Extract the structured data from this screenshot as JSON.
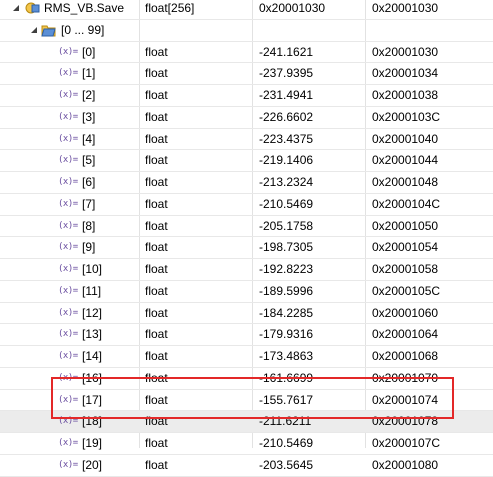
{
  "rows": [
    {
      "name": "RMS_VB.Save",
      "type": "float[256]",
      "value": "0x20001030",
      "location": "0x20001030"
    },
    {
      "name": "[0 ... 99]",
      "type": "",
      "value": "",
      "location": ""
    },
    {
      "name": "[0]",
      "type": "float",
      "value": "-241.1621",
      "location": "0x20001030"
    },
    {
      "name": "[1]",
      "type": "float",
      "value": "-237.9395",
      "location": "0x20001034"
    },
    {
      "name": "[2]",
      "type": "float",
      "value": "-231.4941",
      "location": "0x20001038"
    },
    {
      "name": "[3]",
      "type": "float",
      "value": "-226.6602",
      "location": "0x2000103C"
    },
    {
      "name": "[4]",
      "type": "float",
      "value": "-223.4375",
      "location": "0x20001040"
    },
    {
      "name": "[5]",
      "type": "float",
      "value": "-219.1406",
      "location": "0x20001044"
    },
    {
      "name": "[6]",
      "type": "float",
      "value": "-213.2324",
      "location": "0x20001048"
    },
    {
      "name": "[7]",
      "type": "float",
      "value": "-210.5469",
      "location": "0x2000104C"
    },
    {
      "name": "[8]",
      "type": "float",
      "value": "-205.1758",
      "location": "0x20001050"
    },
    {
      "name": "[9]",
      "type": "float",
      "value": "-198.7305",
      "location": "0x20001054"
    },
    {
      "name": "[10]",
      "type": "float",
      "value": "-192.8223",
      "location": "0x20001058"
    },
    {
      "name": "[11]",
      "type": "float",
      "value": "-189.5996",
      "location": "0x2000105C"
    },
    {
      "name": "[12]",
      "type": "float",
      "value": "-184.2285",
      "location": "0x20001060"
    },
    {
      "name": "[13]",
      "type": "float",
      "value": "-179.9316",
      "location": "0x20001064"
    },
    {
      "name": "[14]",
      "type": "float",
      "value": "-173.4863",
      "location": "0x20001068"
    },
    {
      "name": "[15]",
      "type": "float",
      "value": "-167.5781",
      "location": "0x2000106C"
    },
    {
      "name": "[16]",
      "type": "float",
      "value": "-161.6699",
      "location": "0x20001070"
    },
    {
      "name": "[17]",
      "type": "float",
      "value": "-155.7617",
      "location": "0x20001074"
    },
    {
      "name": "[18]",
      "type": "float",
      "value": "-211.6211",
      "location": "0x20001078"
    },
    {
      "name": "[19]",
      "type": "float",
      "value": "-210.5469",
      "location": "0x2000107C"
    },
    {
      "name": "[20]",
      "type": "float",
      "value": "-203.5645",
      "location": "0x20001080"
    }
  ],
  "var_icon_label": "(x)=",
  "selected_row": "[18]",
  "highlight_color": "#e32828"
}
